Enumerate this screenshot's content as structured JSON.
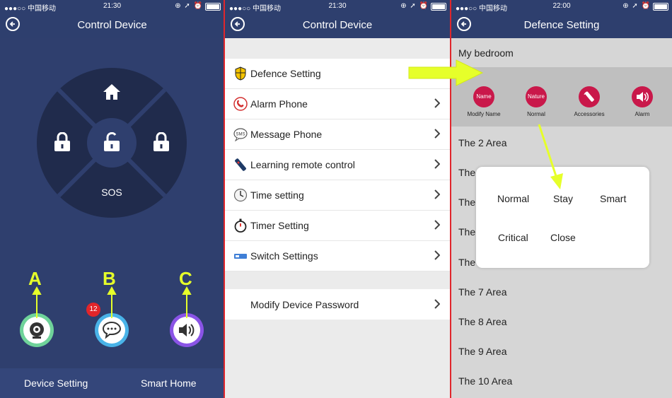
{
  "status": [
    {
      "carrier": "●●●○○ 中国移动",
      "time": "21:30",
      "icons": "⊕ ➚ ⏰"
    },
    {
      "carrier": "●●●○○ 中国移动",
      "time": "21:30",
      "icons": "⊕ ➚ ⏰"
    },
    {
      "carrier": "●●●○○ 中国移动",
      "time": "22:00",
      "icons": "⊕ ➚ ⏰"
    }
  ],
  "screen1": {
    "title": "Control Device",
    "wheel": {
      "sos": "SOS"
    },
    "shortcuts": [
      {
        "letter": "A",
        "icon": "camera-icon",
        "ring": "#6fd39a"
      },
      {
        "letter": "B",
        "icon": "chat-icon",
        "ring": "#49b3e8",
        "badge": "12"
      },
      {
        "letter": "C",
        "icon": "speaker-icon",
        "ring": "#8a54e6"
      }
    ],
    "tabs": {
      "left": "Device Setting",
      "right": "Smart Home"
    }
  },
  "screen2": {
    "title": "Control Device",
    "menu": [
      {
        "label": "Defence Setting",
        "icon": "shield-icon"
      },
      {
        "label": "Alarm Phone",
        "icon": "phone-icon"
      },
      {
        "label": "Message Phone",
        "icon": "sms-icon"
      },
      {
        "label": "Learning remote control",
        "icon": "remote-icon"
      },
      {
        "label": "Time setting",
        "icon": "clock-icon"
      },
      {
        "label": "Timer Setting",
        "icon": "stopwatch-icon"
      },
      {
        "label": "Switch Settings",
        "icon": "switch-icon"
      }
    ],
    "password": "Modify Device Password"
  },
  "screen3": {
    "title": "Defence Setting",
    "room": "My bedroom",
    "options": [
      {
        "circle": "Name",
        "label": "Modify Name"
      },
      {
        "circle": "Nature",
        "label": "Normal"
      },
      {
        "circle": "",
        "label": "Accessories"
      },
      {
        "circle": "",
        "label": "Alarm"
      }
    ],
    "areas": [
      "The 2 Area",
      "The",
      "The",
      "The",
      "The",
      "The 7 Area",
      "The 8 Area",
      "The 9 Area",
      "The 10 Area"
    ],
    "popup": [
      "Normal",
      "Stay",
      "Smart",
      "Critical",
      "Close"
    ]
  },
  "colors": {
    "navbar": "#2e3f6e",
    "accent_arrow": "#e6ff2a",
    "divider": "#e0262c"
  }
}
